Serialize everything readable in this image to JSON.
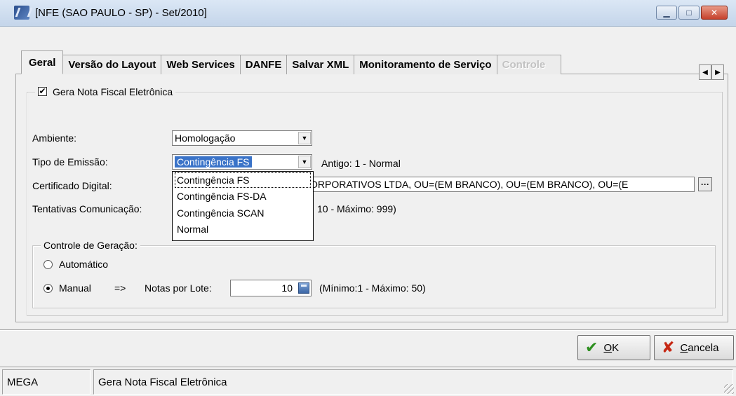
{
  "window": {
    "title": "[NFE (SAO PAULO - SP) - Set/2010]"
  },
  "tabs": [
    {
      "label": "Geral",
      "active": true
    },
    {
      "label": "Versão do Layout"
    },
    {
      "label": "Web Services"
    },
    {
      "label": "DANFE"
    },
    {
      "label": "Salvar XML"
    },
    {
      "label": "Monitoramento de Serviço"
    },
    {
      "label": "Controle",
      "disabled": true
    }
  ],
  "group": {
    "checkbox_label": "Gera Nota Fiscal Eletrônica",
    "checked": true
  },
  "fields": {
    "ambiente_label": "Ambiente:",
    "ambiente_value": "Homologação",
    "tipo_label": "Tipo de Emissão:",
    "tipo_value": "Contingência FS",
    "tipo_hint": "Antigo: 1 - Normal",
    "certificado_label": "Certificado Digital:",
    "certificado_value": "ORPORATIVOS LTDA, OU=(EM BRANCO), OU=(EM BRANCO), OU=(E",
    "tentativas_label": "Tentativas Comunicação:",
    "tentativas_hint": "10 - Máximo: 999)"
  },
  "dropdown_options": [
    "Contingência FS",
    "Contingência FS-DA",
    "Contingência SCAN",
    "Normal"
  ],
  "controle": {
    "legend": "Controle de Geração:",
    "automatico_label": "Automático",
    "manual_label": "Manual",
    "arrow_text": "=>",
    "notas_label": "Notas por Lote:",
    "notas_value": "10",
    "notas_hint": "(Mínimo:1 - Máximo: 50)",
    "selected": "manual"
  },
  "buttons": {
    "ok_underline": "O",
    "ok_rest": "K",
    "cancel_underline": "C",
    "cancel_rest": "ancela"
  },
  "statusbar": {
    "left": "MEGA",
    "right": "Gera Nota Fiscal Eletrônica"
  },
  "colors": {
    "selection": "#3a73c8",
    "ok": "#2d8f1f",
    "cancel": "#c62814"
  }
}
